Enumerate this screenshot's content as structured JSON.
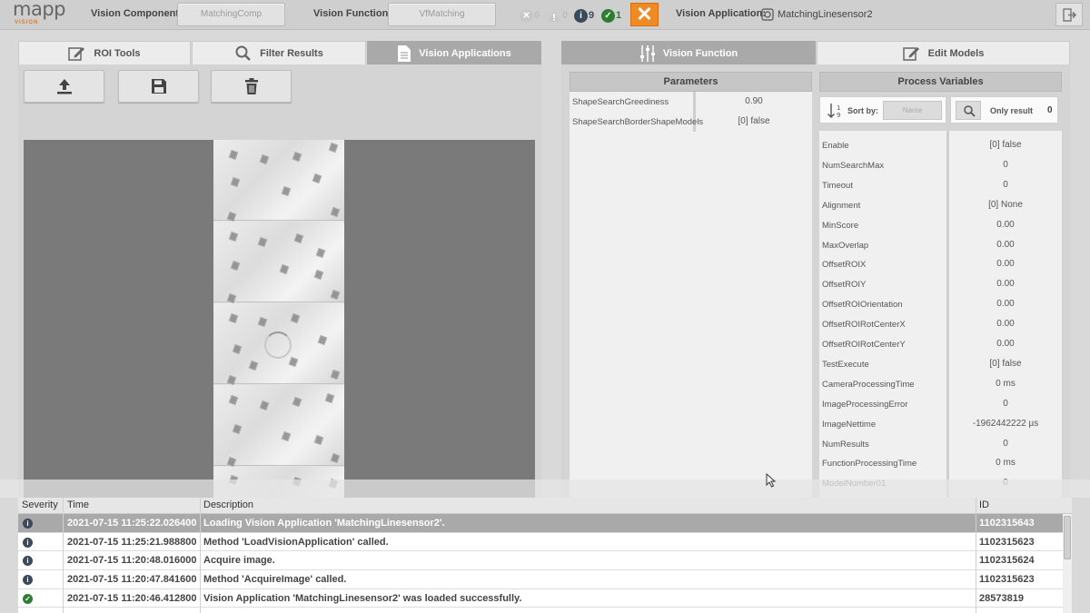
{
  "topbar": {
    "logo_text": "mapp",
    "logo_sub": "VISION",
    "component_label": "Vision Component:",
    "component_value": "MatchingComp",
    "function_label": "Vision Function:",
    "function_value": "VfMatching",
    "status_error_count": "0",
    "status_warning_count": "0",
    "status_info_count": "9",
    "status_success_count": "1",
    "application_label": "Vision Application:",
    "application_value": "MatchingLinesensor2"
  },
  "left_tabs": [
    {
      "label": "ROI Tools"
    },
    {
      "label": "Filter Results"
    },
    {
      "label": "Vision Applications"
    }
  ],
  "right_tabs": [
    {
      "label": "Vision Function"
    },
    {
      "label": "Edit Models"
    }
  ],
  "parameters": {
    "title": "Parameters",
    "rows": [
      {
        "name": "ShapeSearchGreediness",
        "value": "0.90"
      },
      {
        "name": "ShapeSearchBorderShapeModels",
        "value": "[0] false"
      }
    ]
  },
  "process_variables": {
    "title": "Process Variables",
    "sort_label": "Sort by:",
    "sort_value": "Name",
    "only_result_label": "Only result",
    "only_result_value": "0",
    "rows": [
      {
        "name": "Enable",
        "value": "[0] false"
      },
      {
        "name": "NumSearchMax",
        "value": "0"
      },
      {
        "name": "Timeout",
        "value": "0"
      },
      {
        "name": "Alignment",
        "value": "[0] None"
      },
      {
        "name": "MinScore",
        "value": "0.00"
      },
      {
        "name": "MaxOverlap",
        "value": "0.00"
      },
      {
        "name": "OffsetROIX",
        "value": "0.00"
      },
      {
        "name": "OffsetROIY",
        "value": "0.00"
      },
      {
        "name": "OffsetROIOrientation",
        "value": "0.00"
      },
      {
        "name": "OffsetROIRotCenterX",
        "value": "0.00"
      },
      {
        "name": "OffsetROIRotCenterY",
        "value": "0.00"
      },
      {
        "name": "TestExecute",
        "value": "[0] false"
      },
      {
        "name": "CameraProcessingTime",
        "value": "0 ms"
      },
      {
        "name": "ImageProcessingError",
        "value": "0"
      },
      {
        "name": "ImageNettime",
        "value": "-1962442222 µs"
      },
      {
        "name": "NumResults",
        "value": "0"
      },
      {
        "name": "FunctionProcessingTime",
        "value": "0 ms"
      },
      {
        "name": "ModelNumber01",
        "value": "0"
      }
    ]
  },
  "log": {
    "headers": {
      "severity": "Severity",
      "time": "Time",
      "description": "Description",
      "id": "ID"
    },
    "rows": [
      {
        "severity": "info",
        "time": "2021-07-15 11:25:22.026400",
        "description": "Loading Vision Application 'MatchingLinesensor2'.",
        "id": "1102315643"
      },
      {
        "severity": "info",
        "time": "2021-07-15 11:25:21.988800",
        "description": "Method 'LoadVisionApplication' called.",
        "id": "1102315623"
      },
      {
        "severity": "info",
        "time": "2021-07-15 11:20:48.016000",
        "description": "Acquire image.",
        "id": "1102315624"
      },
      {
        "severity": "info",
        "time": "2021-07-15 11:20:47.841600",
        "description": "Method 'AcquireImage' called.",
        "id": "1102315623"
      },
      {
        "severity": "success",
        "time": "2021-07-15 11:20:46.412800",
        "description": "Vision Application 'MatchingLinesensor2' was loaded successfully.",
        "id": "28573819"
      }
    ]
  },
  "colors": {
    "accent": "#f08a24",
    "tab_active": "#a9a9a9",
    "info": "#3a4a5a",
    "success": "#2e7d32"
  }
}
